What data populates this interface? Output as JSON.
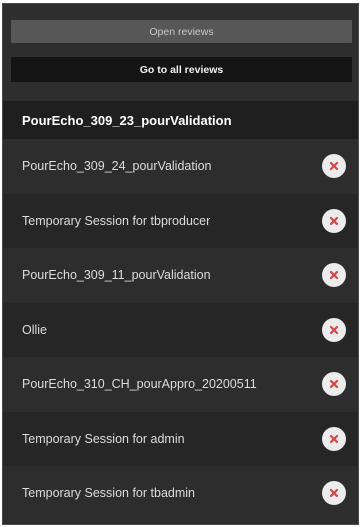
{
  "buttons": {
    "open_reviews": "Open reviews",
    "go_to_all_reviews": "Go to all reviews"
  },
  "current_session": "PourEcho_309_23_pourValidation",
  "sessions": [
    {
      "label": "PourEcho_309_24_pourValidation",
      "icon": "close-icon"
    },
    {
      "label": "Temporary Session for tbproducer",
      "icon": "close-icon"
    },
    {
      "label": "PourEcho_309_11_pourValidation",
      "icon": "close-icon"
    },
    {
      "label": "Ollie",
      "icon": "close-icon"
    },
    {
      "label": "PourEcho_310_CH_pourAppro_20200511",
      "icon": "close-icon"
    },
    {
      "label": "Temporary Session for admin",
      "icon": "close-icon"
    },
    {
      "label": "Temporary Session for tbadmin",
      "icon": "close-icon"
    }
  ],
  "colors": {
    "panel_bg": "#2e2e2e",
    "close_icon_bg": "#ececec",
    "close_icon_x": "#d64545"
  }
}
